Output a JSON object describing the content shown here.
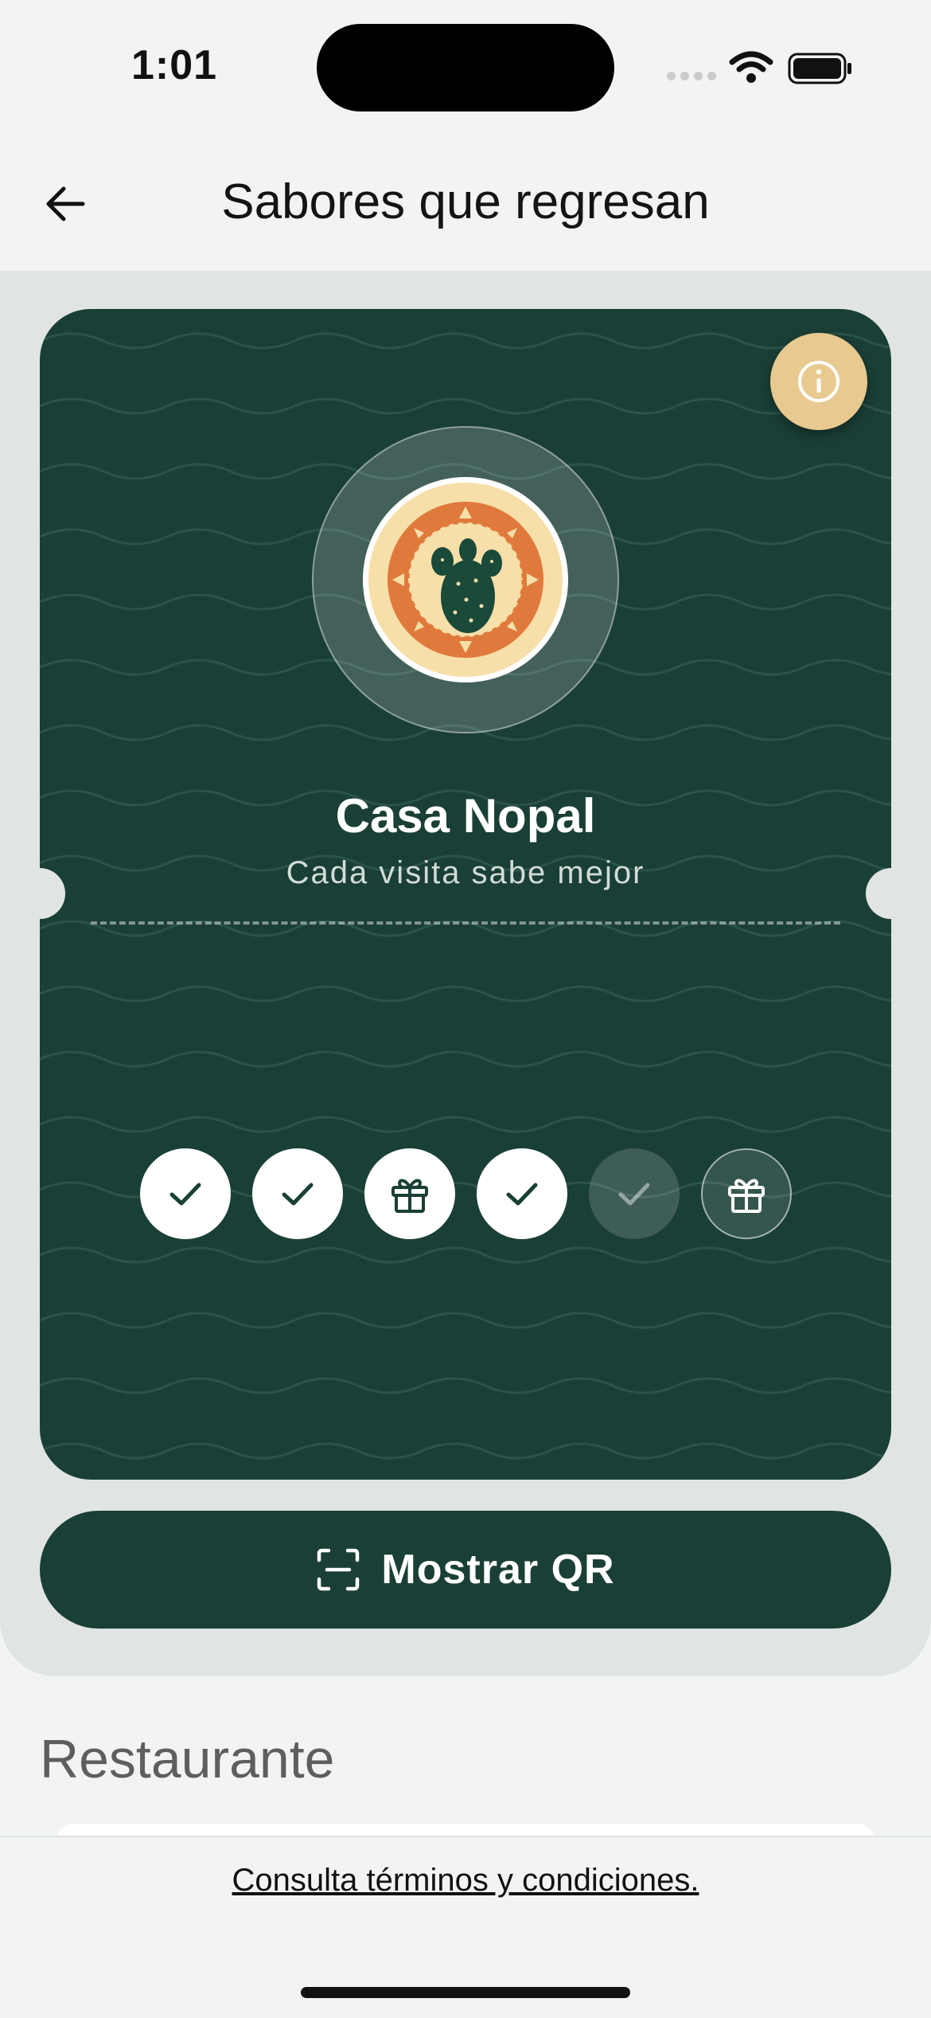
{
  "status_bar": {
    "time": "1:01"
  },
  "header": {
    "title": "Sabores que regresan"
  },
  "card": {
    "brand_name": "Casa Nopal",
    "tagline": "Cada visita sabe mejor",
    "stamps": [
      {
        "type": "check",
        "state": "filled"
      },
      {
        "type": "check",
        "state": "filled"
      },
      {
        "type": "gift",
        "state": "filled"
      },
      {
        "type": "check",
        "state": "filled"
      },
      {
        "type": "check",
        "state": "pending"
      },
      {
        "type": "gift",
        "state": "locked"
      }
    ],
    "accent_color": "#1a3f36",
    "info_button_color": "#e8c98f"
  },
  "qr_button": {
    "label": "Mostrar QR"
  },
  "section": {
    "title": "Restaurante"
  },
  "footer": {
    "terms": "Consulta términos y condiciones."
  }
}
